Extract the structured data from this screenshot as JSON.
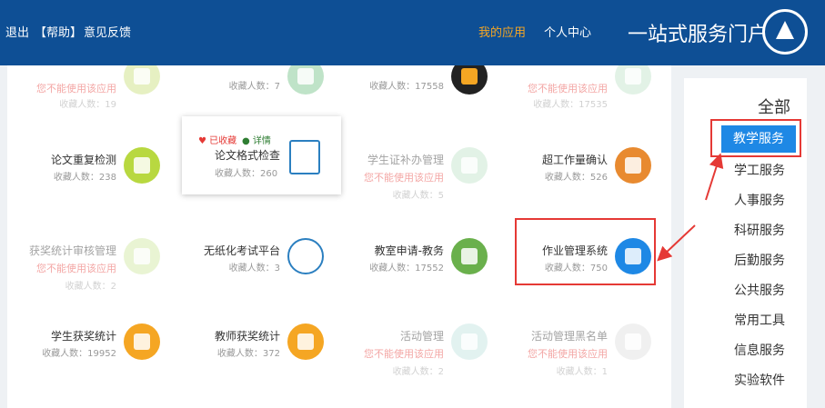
{
  "header": {
    "site_title": "一站式服务门户",
    "nav_personal": "个人中心",
    "nav_my_apps": "我的应用",
    "feedback": "意见反馈",
    "help": "【帮助】",
    "logout": "退出",
    "my_apps_color": "#f5a623"
  },
  "sidebar": {
    "title": "全部",
    "items": [
      {
        "label": "教学服务",
        "active": true
      },
      {
        "label": "学工服务"
      },
      {
        "label": "人事服务"
      },
      {
        "label": "科研服务"
      },
      {
        "label": "后勤服务"
      },
      {
        "label": "公共服务"
      },
      {
        "label": "常用工具"
      },
      {
        "label": "信息服务"
      },
      {
        "label": "实验软件"
      }
    ]
  },
  "apps": [
    {
      "name": "",
      "warn": "您不能使用该应用",
      "count": "收藏人数：19",
      "color": "#c8e07a"
    },
    {
      "name": "",
      "warn": "",
      "count": "收藏人数：7",
      "color": "#bfe3c8"
    },
    {
      "name": "",
      "warn": "",
      "count": "收藏人数：17558",
      "color": "#222222"
    },
    {
      "name": "",
      "warn": "您不能使用该应用",
      "count": "收藏人数：17535",
      "color": "#bfe3c8"
    },
    {
      "name": "论文重复检测",
      "warn": "",
      "count": "收藏人数：238",
      "color": "#b8d840"
    },
    {
      "name": "学生证补办管理",
      "warn": "您不能使用该应用",
      "count": "收藏人数：5",
      "color": "#bfe3c8"
    },
    {
      "name": "超工作量确认",
      "warn": "",
      "count": "收藏人数：526",
      "color": "#e88a30"
    },
    {
      "name": "获奖统计审核管理",
      "warn": "您不能使用该应用",
      "count": "收藏人数：2",
      "color": "#d0e8a0"
    },
    {
      "name": "无纸化考试平台",
      "warn": "",
      "count": "收藏人数：3",
      "color": "#ffffff"
    },
    {
      "name": "教室申请-教务",
      "warn": "",
      "count": "收藏人数：17552",
      "color": "#6ab04c"
    },
    {
      "name": "作业管理系统",
      "warn": "",
      "count": "收藏人数：750",
      "color": "#1e88e5"
    },
    {
      "name": "学生获奖统计",
      "warn": "",
      "count": "收藏人数：19952",
      "color": "#f5a623"
    },
    {
      "name": "教师获奖统计",
      "warn": "",
      "count": "收藏人数：372",
      "color": "#f5a623"
    },
    {
      "name": "活动管理",
      "warn": "您不能使用该应用",
      "count": "收藏人数：2",
      "color": "#bfe3e0"
    },
    {
      "name": "活动管理黑名单",
      "warn": "您不能使用该应用",
      "count": "收藏人数：1",
      "color": "#e0e0e0"
    }
  ],
  "popup": {
    "fav": "♥ 已收藏",
    "info": "● 详情",
    "name": "论文格式检查",
    "count": "收藏人数：260"
  }
}
